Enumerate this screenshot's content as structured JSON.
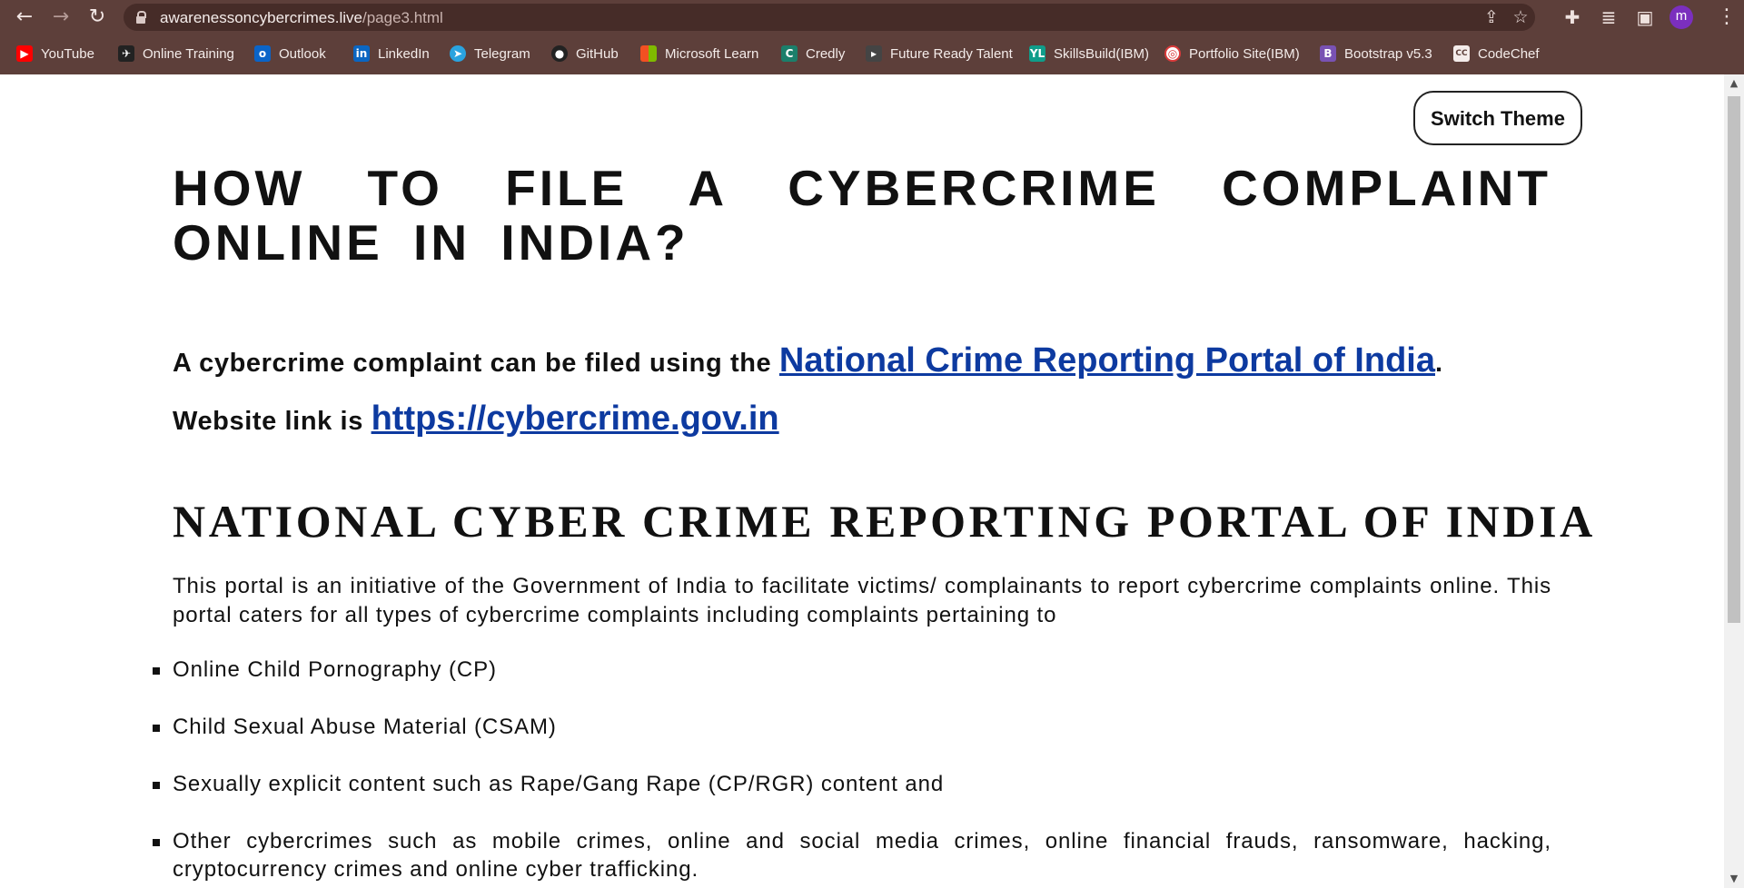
{
  "browser": {
    "url_host": "awarenessoncybercrimes.live",
    "url_path": "/page3.html",
    "profile_initial": "m",
    "bookmarks": [
      {
        "label": "YouTube",
        "icon": "youtube-icon",
        "color": "#ff0000"
      },
      {
        "label": "Online Training",
        "icon": "online-training-icon",
        "color": "#222222"
      },
      {
        "label": "Outlook",
        "icon": "outlook-icon",
        "color": "#0a64c8"
      },
      {
        "label": "LinkedIn",
        "icon": "linkedin-icon",
        "color": "#0a66c2"
      },
      {
        "label": "Telegram",
        "icon": "telegram-icon",
        "color": "#2aa3df"
      },
      {
        "label": "GitHub",
        "icon": "github-icon",
        "color": "#222222"
      },
      {
        "label": "Microsoft Learn",
        "icon": "microsoft-icon",
        "color": "#f25022"
      },
      {
        "label": "Credly",
        "icon": "credly-icon",
        "color": "#1b7f6b"
      },
      {
        "label": "Future Ready Talent",
        "icon": "future-ready-talent-icon",
        "color": "#444444"
      },
      {
        "label": "SkillsBuild(IBM)",
        "icon": "skillsbuild-icon",
        "color": "#0f9d8a"
      },
      {
        "label": "Portfolio Site(IBM)",
        "icon": "portfolio-icon",
        "color": "#d93a3a"
      },
      {
        "label": "Bootstrap v5.3",
        "icon": "bootstrap-icon",
        "color": "#7952b3"
      },
      {
        "label": "CodeChef",
        "icon": "codechef-icon",
        "color": "#6b4a44"
      }
    ]
  },
  "page": {
    "switch_theme_label": "Switch Theme",
    "title": "HOW TO FILE A CYBERCRIME COMPLAINT ONLINE IN INDIA?",
    "intro": {
      "line1_prefix": "A cybercrime complaint can be filed using the ",
      "portal_link_text": "National Crime Reporting Portal of India",
      "line1_suffix": ".",
      "line2_prefix": "Website link is ",
      "website_link_text": "https://cybercrime.gov.in"
    },
    "portal_heading": "NATIONAL CYBER CRIME REPORTING PORTAL OF INDIA",
    "portal_description": "This portal is an initiative of the Government of India to facilitate victims/ complainants to report cybercrime complaints online. This portal caters for all types of cybercrime complaints including complaints pertaining to",
    "crime_types": [
      "Online Child Pornography (CP)",
      "Child Sexual Abuse Material (CSAM)",
      "Sexually explicit content such as Rape/Gang Rape (CP/RGR) content and",
      "Other cybercrimes such as mobile crimes, online and social media crimes, online financial frauds, ransomware, hacking, cryptocurrency crimes and online cyber trafficking."
    ]
  },
  "colors": {
    "chrome_bg": "#5d3f3a",
    "link": "#0d3aa0",
    "text": "#111111",
    "profile": "#7b2fbe"
  }
}
